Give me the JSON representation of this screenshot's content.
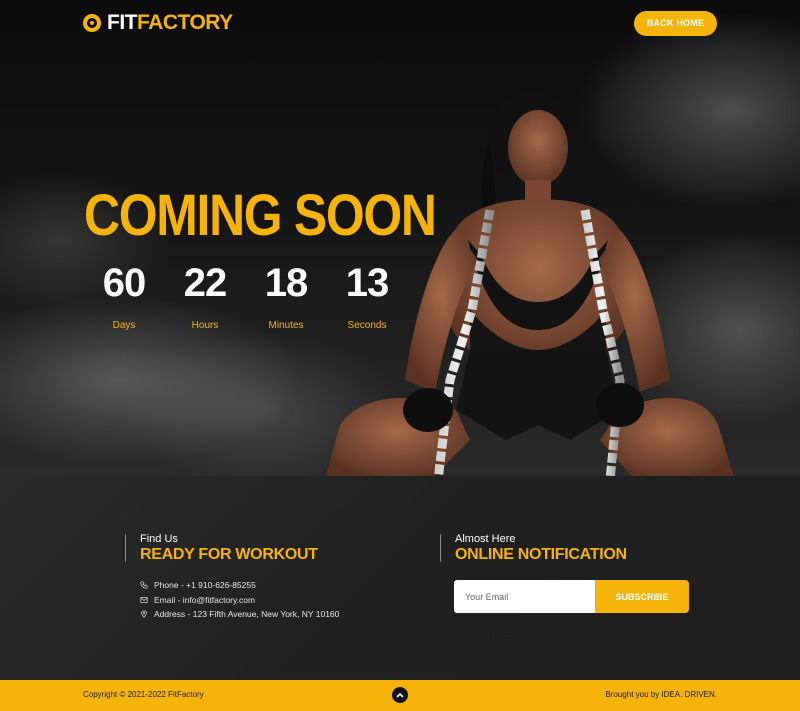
{
  "header": {
    "logo_part1": "FIT",
    "logo_part2": "FACTORY",
    "back_home_label": "BACK HOME"
  },
  "hero": {
    "title": "COMING SOON",
    "countdown": [
      {
        "value": "60",
        "label": "Days"
      },
      {
        "value": "22",
        "label": "Hours"
      },
      {
        "value": "18",
        "label": "Minutes"
      },
      {
        "value": "13",
        "label": "Seconds"
      }
    ]
  },
  "contact": {
    "kicker": "Find Us",
    "title": "READY FOR WORKOUT",
    "phone": "Phone - +1 910-626-85255",
    "email": "Email - info@fitfactory.com",
    "address": "Address - 123 Fifth Avenue, New York, NY 10160"
  },
  "newsletter": {
    "kicker": "Almost Here",
    "title": "ONLINE NOTIFICATION",
    "email_placeholder": "Your Email",
    "email_value": "",
    "subscribe_label": "SUBSCRIBE"
  },
  "footer": {
    "copyright": "Copyright © 2021-2022 FitFactory",
    "brought_by": "Brought you by IDEA. DRIVEN."
  },
  "icons": {
    "logo": "target-icon",
    "phone": "phone-icon",
    "email": "envelope-icon",
    "address": "map-pin-icon",
    "to_top": "chevron-up-icon"
  },
  "colors": {
    "accent": "#f6b40b",
    "dark": "#1b1b1b"
  }
}
